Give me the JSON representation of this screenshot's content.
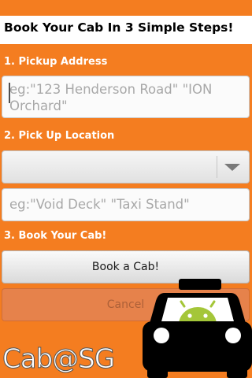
{
  "header": {
    "title": "Book Your Cab In 3 Simple Steps!"
  },
  "step1": {
    "label": "1. Pickup Address",
    "address_placeholder": "eg:\"123 Henderson Road\" \"ION Orchard\""
  },
  "step2": {
    "label": "2. Pick Up Location",
    "location_select_value": "",
    "location_detail_placeholder": "eg:\"Void Deck\" \"Taxi Stand\""
  },
  "step3": {
    "label": "3. Book Your Cab!",
    "book_button": "Book a Cab!",
    "cancel_button": "Cancel"
  },
  "brand": {
    "name": "Cab@SG"
  },
  "icons": {
    "dropdown": "chevron-down-icon",
    "logo": "taxi-android-icon"
  },
  "colors": {
    "background": "#f47d20",
    "header_bg": "#ffffff",
    "section_label": "#ffffff",
    "taxi_body": "#000000",
    "android_green": "#a4c639"
  }
}
